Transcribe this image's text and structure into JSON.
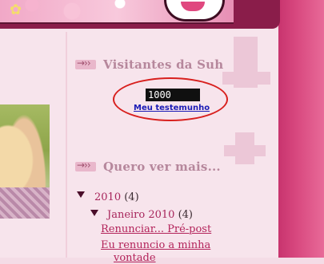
{
  "sidebar": {
    "visitors_widget": {
      "title": "Visitantes da Suh",
      "counter_value": "1000",
      "testimonial_link": "Meu testemunho"
    },
    "archive_widget": {
      "title": "Quero ver mais...",
      "year": {
        "label": "2010",
        "count": "(4)"
      },
      "month": {
        "label": "Janeiro 2010",
        "count": "(4)"
      },
      "posts": [
        "Renunciar... Pré-post",
        "Eu renuncio a minha",
        "vontade"
      ]
    }
  },
  "icons": {
    "heading_arrow": "arrow-right-icon",
    "expand": "triangle-down-icon"
  },
  "colors": {
    "heading_text": "#b6879c",
    "link_blue": "#1a1ab5",
    "archive_link": "#b3235a",
    "highlight_ring": "#d8201e",
    "side_stripe": "#d8487f"
  }
}
